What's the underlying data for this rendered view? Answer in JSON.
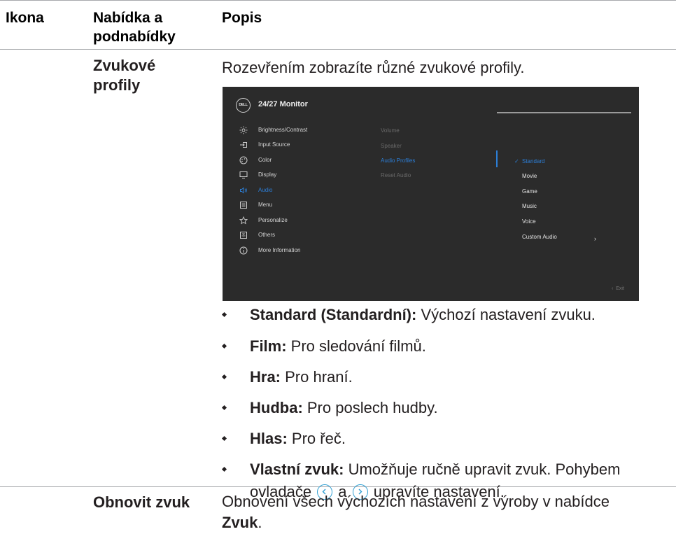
{
  "header": {
    "col_icon": "Ikona",
    "col_menu_line1": "Nabídka a",
    "col_menu_line2": "podnabídky",
    "col_desc": "Popis"
  },
  "audio_profiles": {
    "name_line1": "Zvukové",
    "name_line2": "profily",
    "intro": "Rozevřením zobrazíte různé zvukové profily."
  },
  "osd": {
    "logo": "DELL",
    "title": "24/27 Monitor",
    "menu_items": [
      {
        "label": "Brightness/Contrast",
        "icon": "brightness-icon"
      },
      {
        "label": "Input Source",
        "icon": "input-source-icon"
      },
      {
        "label": "Color",
        "icon": "color-icon"
      },
      {
        "label": "Display",
        "icon": "display-icon"
      },
      {
        "label": "Audio",
        "icon": "audio-icon"
      },
      {
        "label": "Menu",
        "icon": "menu-icon"
      },
      {
        "label": "Personalize",
        "icon": "star-icon"
      },
      {
        "label": "Others",
        "icon": "others-icon"
      },
      {
        "label": "More Information",
        "icon": "info-icon"
      }
    ],
    "active_menu": "Audio",
    "submenu": [
      "Volume",
      "Speaker",
      "Audio Profiles",
      "Reset Audio"
    ],
    "active_submenu": "Audio Profiles",
    "options": [
      "Standard",
      "Movie",
      "Game",
      "Music",
      "Voice",
      "Custom Audio"
    ],
    "selected_option": "Standard",
    "exit_label": "Exit",
    "accent_color": "#2c7ed6",
    "background_color": "#2b2b2b"
  },
  "bullets": [
    {
      "term": "Standard (Standardní):",
      "text": " Výchozí nastavení zvuku."
    },
    {
      "term": "Film:",
      "text": " Pro sledování filmů."
    },
    {
      "term": "Hra:",
      "text": " Pro hraní."
    },
    {
      "term": "Hudba:",
      "text": " Pro poslech hudby."
    },
    {
      "term": "Hlas:",
      "text": " Pro řeč."
    },
    {
      "term": "Vlastní zvuk:",
      "text": " Umožňuje ručně upravit zvuk. Pohybem"
    }
  ],
  "custom_audio_cont": {
    "before": "ovladače ",
    "middle": " a ",
    "after": " upravíte nastavení."
  },
  "reset_audio": {
    "name": "Obnovit zvuk",
    "desc_line1": "Obnovení všech výchozích nastavení z výroby v nabídce",
    "desc_bold": "Zvuk",
    "desc_end": "."
  }
}
